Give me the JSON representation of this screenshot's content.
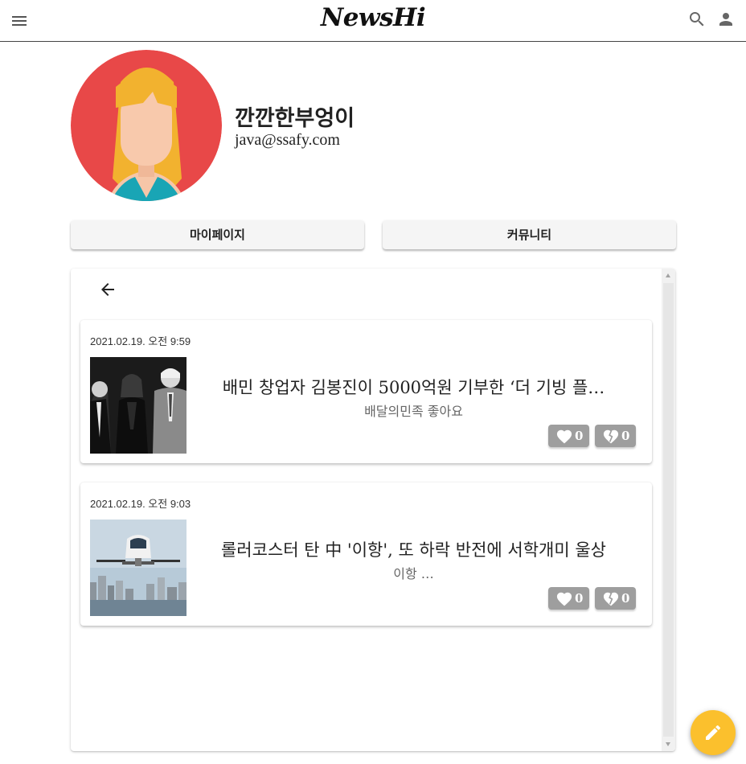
{
  "header": {
    "logo": "NewsHi"
  },
  "profile": {
    "name": "깐깐한부엉이",
    "email": "java@ssafy.com"
  },
  "tabs": {
    "mypage": "마이페이지",
    "community": "커뮤니티"
  },
  "posts": [
    {
      "date": "2021.02.19. 오전 9:59",
      "title": "배민 창업자 김봉진이 5000억원 기부한 ‘더 기빙 플…",
      "summary": "배달의민족 좋아요",
      "likes": "0",
      "dislikes": "0"
    },
    {
      "date": "2021.02.19. 오전 9:03",
      "title": "롤러코스터 탄 中 '이항', 또 하락 반전에 서학개미 울상",
      "summary": "이항 …",
      "likes": "0",
      "dislikes": "0"
    }
  ],
  "colors": {
    "accent_fab": "#fbc02d",
    "avatar_bg": "#e84848",
    "reaction_button": "#9e9e9e"
  },
  "icons": {
    "menu": "menu-icon",
    "search": "search-icon",
    "account": "account-icon",
    "back": "arrow-back-icon",
    "like": "heart-icon",
    "dislike": "broken-heart-icon",
    "fab": "pencil-icon"
  }
}
